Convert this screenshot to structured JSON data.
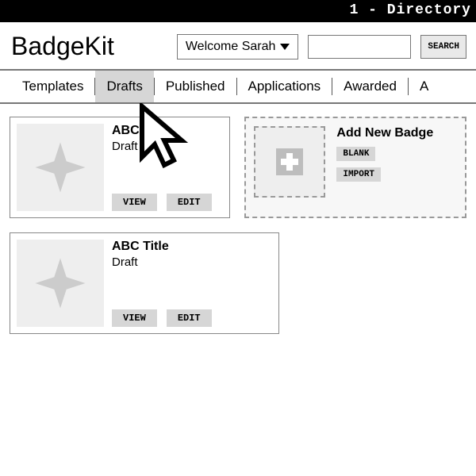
{
  "topbar": {
    "title": "1 - Directory"
  },
  "header": {
    "brand": "BadgeKit",
    "user_dropdown": "Welcome Sarah",
    "search_button": "SEARCH"
  },
  "tabs": {
    "items": [
      {
        "label": "Templates"
      },
      {
        "label": "Drafts"
      },
      {
        "label": "Published"
      },
      {
        "label": "Applications"
      },
      {
        "label": "Awarded"
      },
      {
        "label": "A"
      }
    ],
    "active_index": 1
  },
  "cards": [
    {
      "title": "ABC Title",
      "status": "Draft",
      "view": "VIEW",
      "edit": "EDIT"
    },
    {
      "title": "ABC Title",
      "status": "Draft",
      "view": "VIEW",
      "edit": "EDIT"
    }
  ],
  "add_card": {
    "title": "Add New Badge",
    "blank": "BLANK",
    "import": "IMPORT"
  }
}
